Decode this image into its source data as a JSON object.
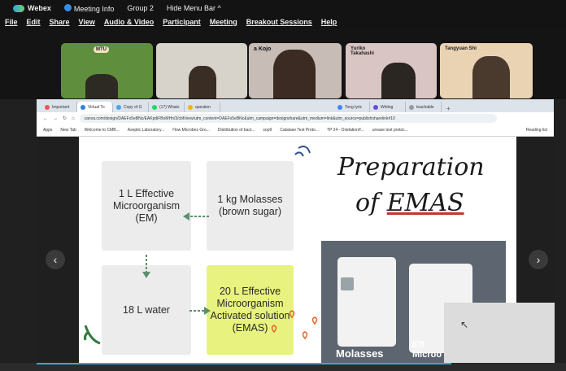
{
  "webex": {
    "app_name": "Webex",
    "meeting_info": "Meeting Info",
    "group": "Group 2",
    "hide_menu": "Hide Menu Bar"
  },
  "menu": [
    "File",
    "Edit",
    "Share",
    "View",
    "Audio & Video",
    "Participant",
    "Meeting",
    "Breakout Sessions",
    "Help"
  ],
  "participants": {
    "tile1_badge": "MTU",
    "tile3_name": "a Kojo",
    "tile4_name": "Yuriko Takahashi",
    "tile5_name": "Tangyuan Shi"
  },
  "browser": {
    "tabs": [
      "Important",
      "Virtual To",
      "Copy of G",
      "(17) Whats",
      "question",
      "Tong lyric",
      "Writing",
      "teachable"
    ],
    "url": "canva.com/design/DAEFx5eBNc/EAKpdiFBoMHn/3/cbf/view/utm_content=DAEFx5eBNc&utm_campaign=designshare&utm_medium=link&utm_source=publishsharelink#10",
    "bookmarks": [
      "Apps",
      "New Tab",
      "Welcome to CMB...",
      "Aseptic Laboratory...",
      "How Microbes Gro...",
      "Distribution of bact...",
      "sop9",
      "Catalase Test Proto...",
      "TP 24 - Oxidation/f...",
      "urease test protoc..."
    ],
    "reading_list": "Reading list"
  },
  "slide": {
    "box1": "1 L Effective Microorganism (EM)",
    "box2": "1 kg Molasses (brown sugar)",
    "box3": "18 L water",
    "box4": "20 L Effective Microorganism Activated solution (EMAS)",
    "title_line1": "Preparation",
    "title_of": "of",
    "title_emas": "EMAS",
    "photo_label1": "Molasses",
    "photo_label2": "Eff Microo"
  },
  "nav": {
    "prev": "‹",
    "next": "›"
  }
}
